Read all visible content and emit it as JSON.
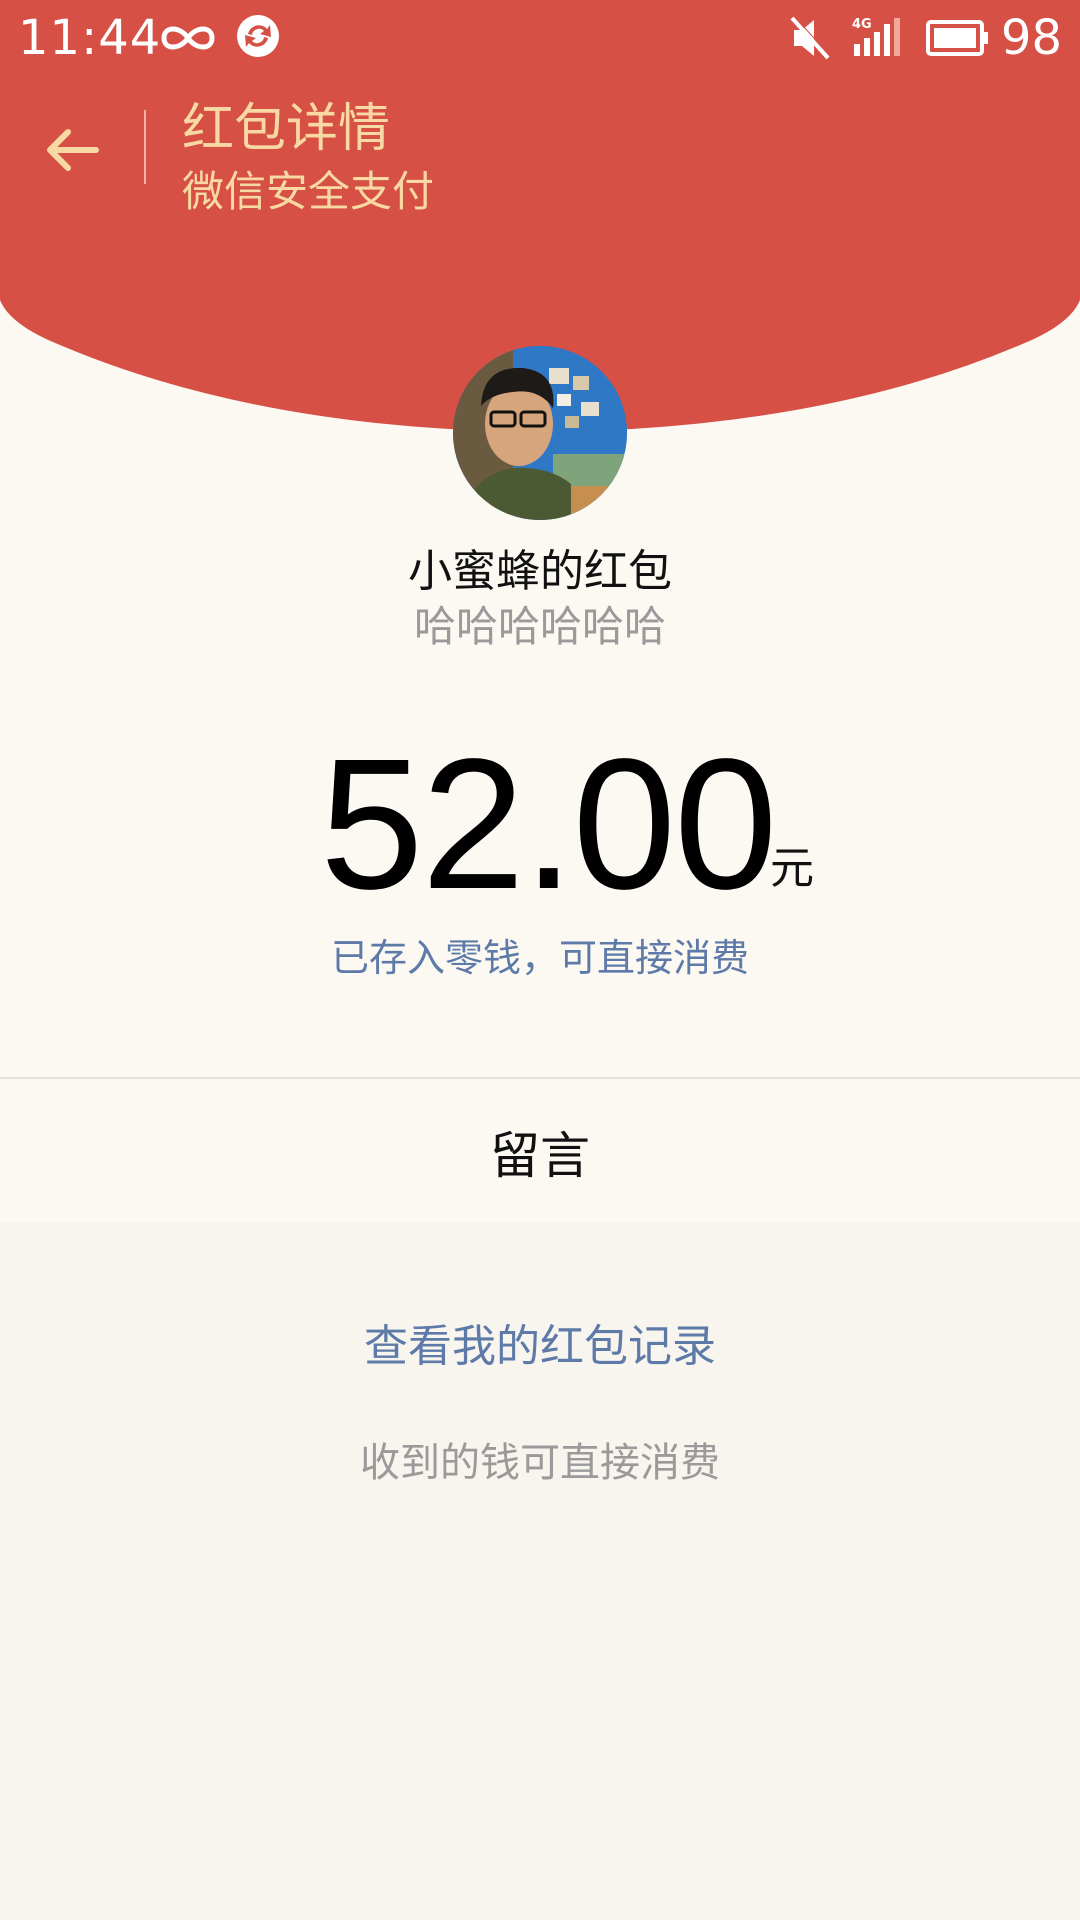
{
  "status_bar": {
    "time": "11:44",
    "battery_percent": "98",
    "icons": [
      "infinity-icon",
      "sync-icon",
      "mute-icon",
      "signal-4g-icon",
      "battery-icon"
    ]
  },
  "header": {
    "title": "红包详情",
    "subtitle": "微信安全支付",
    "background_color": "#d65045",
    "text_color": "#f9d9a3"
  },
  "envelope": {
    "sender_label": "小蜜蜂的红包",
    "wish_text": "哈哈哈哈哈哈",
    "amount": "52.00",
    "unit": "元",
    "stored_note": "已存入零钱，可直接消费"
  },
  "actions": {
    "message_label": "留言",
    "records_link": "查看我的红包记录",
    "footer_note": "收到的钱可直接消费"
  }
}
